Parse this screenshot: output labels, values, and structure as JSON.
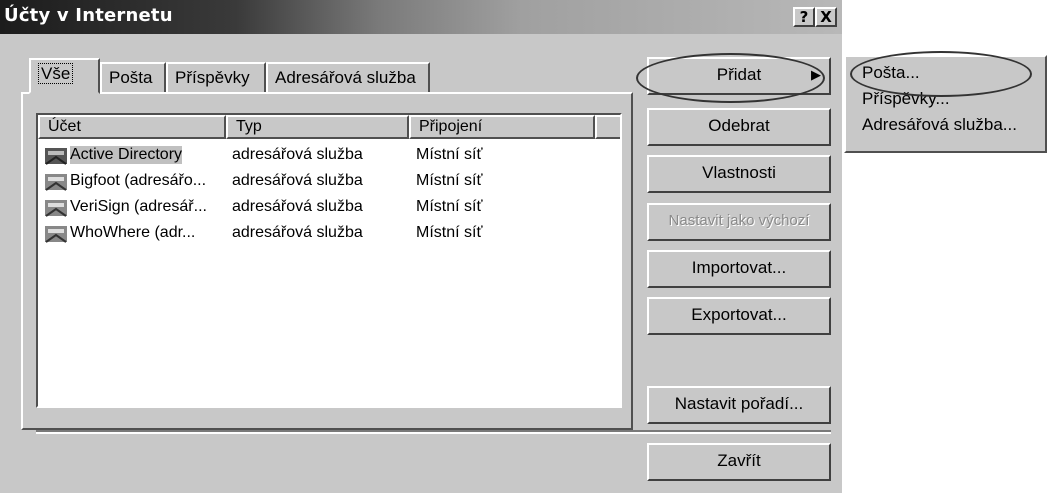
{
  "window": {
    "title": "Účty v Internetu",
    "help_button": "?",
    "close_button": "X"
  },
  "tabs": [
    "Vše",
    "Pošta",
    "Příspěvky",
    "Adresářová služba"
  ],
  "active_tab": "Vše",
  "list": {
    "columns": [
      "Účet",
      "Typ",
      "Připojení"
    ],
    "rows": [
      {
        "account": "Active Directory",
        "type": "adresářová služba",
        "connection": "Místní síť",
        "selected": true
      },
      {
        "account": "Bigfoot (adresářo...",
        "type": "adresářová služba",
        "connection": "Místní síť"
      },
      {
        "account": "VeriSign (adresář...",
        "type": "adresářová služba",
        "connection": "Místní síť"
      },
      {
        "account": "WhoWhere (adr...",
        "type": "adresářová služba",
        "connection": "Místní síť"
      }
    ]
  },
  "buttons": {
    "add": "Přidat",
    "remove": "Odebrat",
    "properties": "Vlastnosti",
    "set_default": "Nastavit jako výchozí",
    "import": "Importovat...",
    "export": "Exportovat...",
    "set_order": "Nastavit pořadí...",
    "close": "Zavřít"
  },
  "add_menu": [
    "Pošta...",
    "Příspěvky...",
    "Adresářová služba..."
  ],
  "icons": {
    "account": "address-book-icon",
    "submenu_arrow": "triangle-right-icon"
  },
  "colors": {
    "dialog_bg": "#c8c8c8",
    "title_dark": "#1c1c1c",
    "list_bg": "#ffffff"
  }
}
